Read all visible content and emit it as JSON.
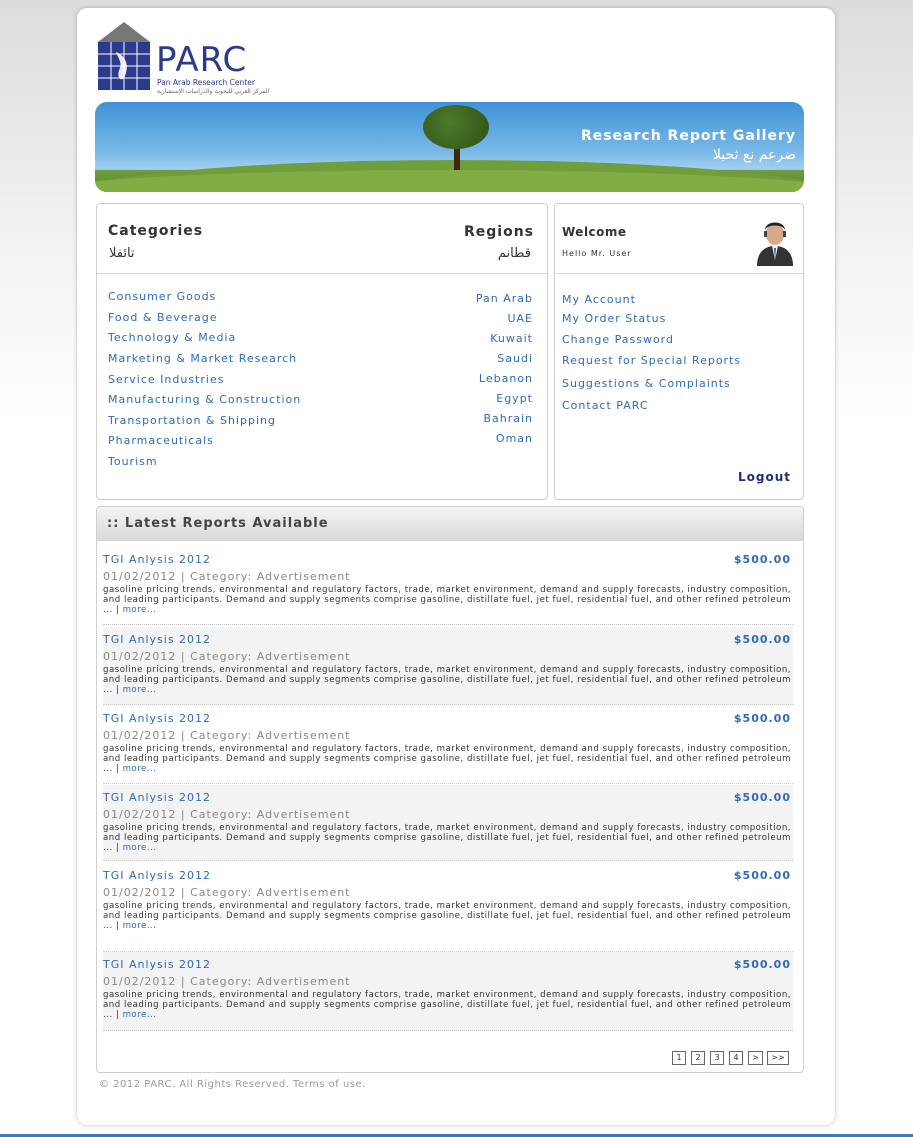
{
  "logo": {
    "name": "PARC",
    "sub": "Pan Arab Research Center",
    "sub_ar": "المركز العربي للبحوث والدراسات الإستشارية"
  },
  "banner": {
    "title": "Research Report Gallery",
    "title_ar": "ضرعم نع ثحبلا"
  },
  "categories": {
    "title": "Categories",
    "title_ar": "تائفلا",
    "items": [
      "Consumer Goods",
      "Food & Beverage",
      "Technology & Media",
      "Marketing & Market Research",
      "Service Industries",
      "Manufacturing & Construction",
      "Transportation & Shipping",
      "Pharmaceuticals",
      "Tourism"
    ]
  },
  "regions": {
    "title": "Regions",
    "title_ar": "قطانم",
    "items": [
      "Pan Arab",
      "UAE",
      "Kuwait",
      "Saudi",
      "Lebanon",
      "Egypt",
      "Bahrain",
      "Oman"
    ]
  },
  "welcome": {
    "title": "Welcome",
    "greeting": "Hello Mr. User",
    "links": [
      "My Account",
      "My Order Status",
      "Change Password",
      "Request for Special Reports",
      "Suggestions & Complaints",
      "Contact PARC"
    ],
    "logout": "Logout"
  },
  "reports": {
    "heading": ":: Latest Reports Available",
    "items": [
      {
        "title": "TGI Anlysis 2012",
        "price": "$500.00",
        "date": "01/02/2012 | Category: Advertisement",
        "desc": "gasoline pricing trends, environmental and regulatory factors, trade, market environment, demand and supply forecasts, industry composition, and leading participants. Demand and supply segments comprise gasoline, distillate fuel, jet fuel, residential fuel, and other refined petroleum ...  |  ",
        "more": "more..."
      },
      {
        "title": "TGI Anlysis 2012",
        "price": "$500.00",
        "date": "01/02/2012 | Category: Advertisement",
        "desc": "gasoline pricing trends, environmental and regulatory factors, trade, market environment, demand and supply forecasts, industry composition, and leading participants. Demand and supply segments comprise gasoline, distillate fuel, jet fuel, residential fuel, and other refined petroleum ...  |  ",
        "more": "more..."
      },
      {
        "title": "TGI Anlysis 2012",
        "price": "$500.00",
        "date": "01/02/2012 | Category: Advertisement",
        "desc": "gasoline pricing trends, environmental and regulatory factors, trade, market environment, demand and supply forecasts, industry composition, and leading participants. Demand and supply segments comprise gasoline, distillate fuel, jet fuel, residential fuel, and other refined petroleum ...  |  ",
        "more": "more..."
      },
      {
        "title": "TGI Anlysis 2012",
        "price": "$500.00",
        "date": "01/02/2012 | Category: Advertisement",
        "desc": "gasoline pricing trends, environmental and regulatory factors, trade, market environment, demand and supply forecasts, industry composition, and leading participants. Demand and supply segments comprise gasoline, distillate fuel, jet fuel, residential fuel, and other refined petroleum ...  |  ",
        "more": "more..."
      },
      {
        "title": "TGI Anlysis 2012",
        "price": "$500.00",
        "date": "01/02/2012 | Category: Advertisement",
        "desc": "gasoline pricing trends, environmental and regulatory factors, trade, market environment, demand and supply forecasts, industry composition, and leading participants. Demand and supply segments comprise gasoline, distillate fuel, jet fuel, residential fuel, and other refined petroleum ...  |  ",
        "more": "more..."
      },
      {
        "title": "TGI Anlysis 2012",
        "price": "$500.00",
        "date": "01/02/2012 | Category: Advertisement",
        "desc": "gasoline pricing trends, environmental and regulatory factors, trade, market environment, demand and supply forecasts, industry composition, and leading participants. Demand and supply segments comprise gasoline, distillate fuel, jet fuel, residential fuel, and other refined petroleum ...  |  ",
        "more": "more..."
      }
    ]
  },
  "pager": [
    "1",
    "2",
    "3",
    "4",
    ">",
    ">>"
  ],
  "footer": "© 2012 PARC. All Rights Reserved. Terms of use."
}
